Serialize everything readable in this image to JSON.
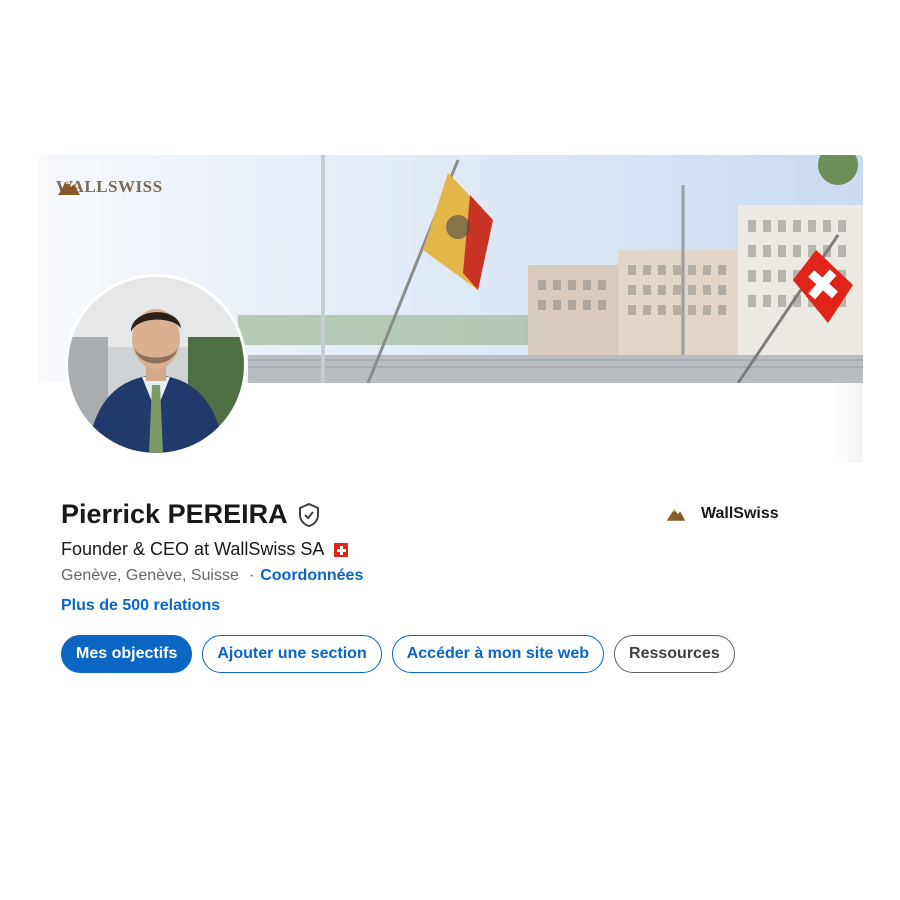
{
  "banner": {
    "logo_text": "WALLSWISS",
    "logo_icon": "wallswiss-logo-icon"
  },
  "profile": {
    "name": "Pierrick PEREIRA",
    "verified_icon": "shield-check-icon",
    "headline": "Founder & CEO at WallSwiss SA",
    "headline_flag": "swiss-flag-icon",
    "location": "Genève, Genève, Suisse",
    "separator": "·",
    "contact_link": "Coordonnées",
    "relations": "Plus de 500 relations"
  },
  "company": {
    "name": "WallSwiss",
    "logo_icon": "wallswiss-logo-icon"
  },
  "actions": [
    {
      "label": "Mes objectifs"
    },
    {
      "label": "Ajouter une section"
    },
    {
      "label": "Accéder à mon site web"
    },
    {
      "label": "Ressources"
    }
  ],
  "colors": {
    "link_blue": "#0a66c2",
    "text_dark": "#191919",
    "text_muted": "#666666",
    "swiss_red": "#e2231a"
  }
}
